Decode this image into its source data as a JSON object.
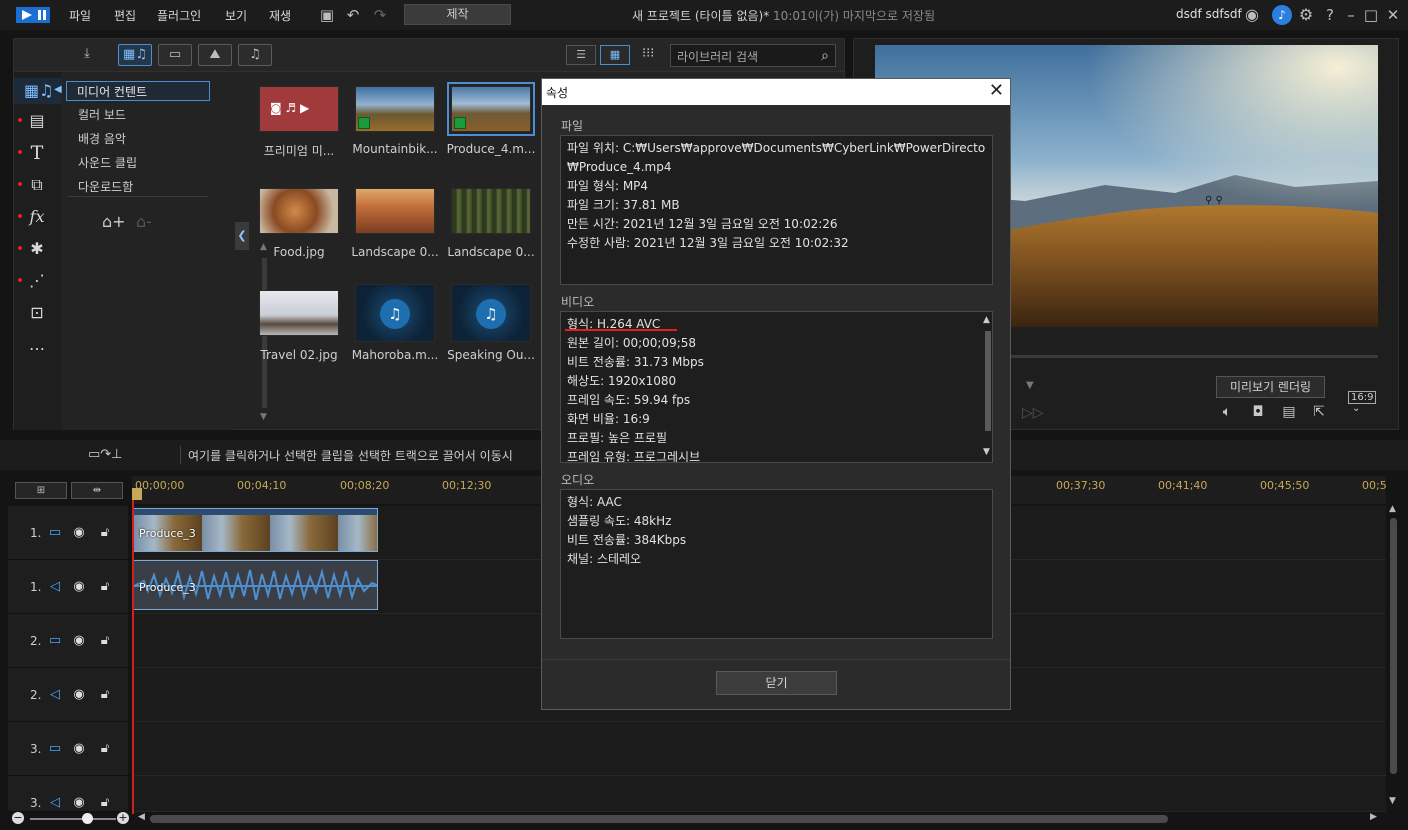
{
  "titlebar": {
    "menu": [
      "파일",
      "편집",
      "플러그인",
      "보기",
      "재생"
    ],
    "produce_label": "제작",
    "project_title": "새 프로젝트 (타이틀 없음)*",
    "saved_note": "10:01이(가) 마지막으로 저장됨",
    "user": "dsdf sdfsdf"
  },
  "library": {
    "search_placeholder": "라이브러리 검색",
    "categories": [
      "미디어 컨텐트",
      "컬러 보드",
      "배경 음악",
      "사운드 클립",
      "다운로드함"
    ],
    "items": [
      {
        "label": "프리미엄 미...",
        "kind": "premium"
      },
      {
        "label": "Mountainbik...",
        "kind": "video"
      },
      {
        "label": "Produce_4.m...",
        "kind": "video",
        "selected": true
      },
      {
        "label": "Food.jpg",
        "kind": "image"
      },
      {
        "label": "Landscape 0...",
        "kind": "image"
      },
      {
        "label": "Landscape 0...",
        "kind": "image"
      },
      {
        "label": "Travel 02.jpg",
        "kind": "image"
      },
      {
        "label": "Mahoroba.m...",
        "kind": "audio"
      },
      {
        "label": "Speaking Ou...",
        "kind": "audio"
      }
    ]
  },
  "preview": {
    "render_label": "미리보기 렌더링",
    "aspect": "16:9"
  },
  "timeline": {
    "hint": "여기를 클릭하거나 선택한 클립을 선택한 트랙으로 끌어서 이동시",
    "ruler": [
      "00;00;00",
      "00;04;10",
      "00;08;20",
      "00;12;30",
      "00;37;30",
      "00;41;40",
      "00;45;50",
      "00;5"
    ],
    "tracks": [
      "1.",
      "1.",
      "2.",
      "2.",
      "3.",
      "3."
    ],
    "clip_video": "Produce_3",
    "clip_audio": "Produce_3"
  },
  "dialog": {
    "title": "속성",
    "file_label": "파일",
    "file_lines": [
      "파일 위치: C:₩Users₩approve₩Documents₩CyberLink₩PowerDirector",
      "₩Produce_4.mp4",
      "파일 형식: MP4",
      "파일 크기: 37.81 MB",
      "만든 시간: 2021년 12월 3일 금요일 오전 10:02:26",
      "수정한 사람: 2021년 12월 3일 금요일 오전 10:02:32"
    ],
    "video_label": "비디오",
    "video_lines": [
      "형식: H.264 AVC",
      "원본 길이: 00;00;09;58",
      "비트 전송률: 31.73 Mbps",
      "해상도: 1920x1080",
      "프레임 속도: 59.94 fps",
      "화면 비율: 16:9",
      "프로필: 높은 프로필",
      "프레임 유형: 프로그레시브"
    ],
    "audio_label": "오디오",
    "audio_lines": [
      "형식: AAC",
      "샘플링 속도: 48kHz",
      "비트 전송률: 384Kbps",
      "채널: 스테레오"
    ],
    "close_label": "닫기"
  },
  "colors": {
    "accent": "#4a8fd4",
    "highlight": "#e02020",
    "ruler": "#c8a856"
  }
}
